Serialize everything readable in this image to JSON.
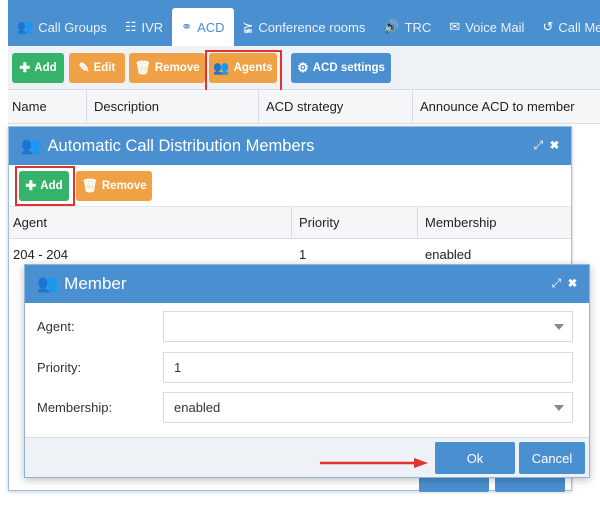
{
  "tabs": [
    {
      "label": "Call Groups",
      "icon": "users-icon"
    },
    {
      "label": "IVR",
      "icon": "sitemap-icon"
    },
    {
      "label": "ACD",
      "icon": "headset-icon",
      "active": true
    },
    {
      "label": "Conference rooms",
      "icon": "share-icon"
    },
    {
      "label": "TRC",
      "icon": "volume-icon"
    },
    {
      "label": "Voice Mail",
      "icon": "envelope-icon"
    },
    {
      "label": "Call Me",
      "icon": "history-icon"
    }
  ],
  "toolbar": {
    "add_label": "Add",
    "edit_label": "Edit",
    "remove_label": "Remove",
    "agents_label": "Agents",
    "acd_settings_label": "ACD settings"
  },
  "main_table": {
    "columns": [
      "Name",
      "Description",
      "ACD strategy",
      "Announce ACD to member"
    ]
  },
  "members_dialog": {
    "title": "Automatic Call Distribution Members",
    "add_label": "Add",
    "remove_label": "Remove",
    "columns": [
      "Agent",
      "Priority",
      "Membership"
    ],
    "rows": [
      {
        "agent": "204 - 204",
        "priority": "1",
        "membership": "enabled"
      }
    ]
  },
  "member_dialog": {
    "title": "Member",
    "agent_label": "Agent:",
    "agent_value": "",
    "priority_label": "Priority:",
    "priority_value": "1",
    "membership_label": "Membership:",
    "membership_value": "enabled",
    "ok_label": "Ok",
    "cancel_label": "Cancel"
  },
  "colors": {
    "primary": "#4a8fcf",
    "success": "#36b36b",
    "warning": "#f0a146",
    "highlight": "#e0322f"
  }
}
